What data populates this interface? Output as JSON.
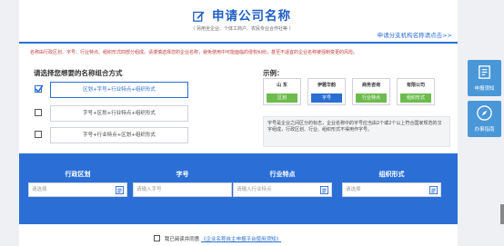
{
  "header": {
    "title": "申请公司名称",
    "subtitle": "（ 另用全企业、个体工商户、农民专业合作社等 ）",
    "branch_link": "申请分支机构名称请点击>>"
  },
  "notice": "名称由行政区划、字号、行业特点、组织形式四部分组成。请谨慎选择您的企业名称，避免使用中可能面临的侵权纠纷，甚至不适宜的企业名称被强制变更的风险。",
  "combo": {
    "title": "请选择您想要的名称组合方式",
    "options": [
      {
        "label": "区划+字号+行业特点+组织形式",
        "checked": true
      },
      {
        "label": "字号+区划+行业特点+组织形式",
        "checked": false
      },
      {
        "label": "字号+行业特点+区划+组织形式",
        "checked": false
      }
    ]
  },
  "example": {
    "title": "示例：",
    "cards": [
      {
        "top": "山 东",
        "label": "区划",
        "color": "green"
      },
      {
        "top": "伊雅华韵",
        "label": "字号",
        "color": "blue"
      },
      {
        "top": "商务咨询",
        "label": "行业特点",
        "color": "green"
      },
      {
        "top": "有限公司",
        "label": "组织形式",
        "color": "green"
      }
    ],
    "description": "字号是企业之间区分的标志，企业名称中的字号应当由2个或2个以上符合国家规范的汉字组成，行政区划、行业、组织形式不得用作字号。"
  },
  "fields": [
    {
      "label": "行政区划",
      "placeholder": "请选择"
    },
    {
      "label": "字号",
      "placeholder": "请输入字号"
    },
    {
      "label": "行业特点",
      "placeholder": "请输入行业特点"
    },
    {
      "label": "组织形式",
      "placeholder": "请选择"
    }
  ],
  "agree": {
    "text": "我已阅读并同意",
    "link": "《企业名称自主申报平台使用须知》"
  },
  "sidebar": [
    {
      "label": "申报须知",
      "icon": "document-icon"
    },
    {
      "label": "办事指南",
      "icon": "compass-icon"
    }
  ],
  "colors": {
    "primary": "#2b6fd6",
    "green": "#6dbb4d",
    "sidebar": "#4a97d8",
    "warning": "#c23b3b"
  }
}
